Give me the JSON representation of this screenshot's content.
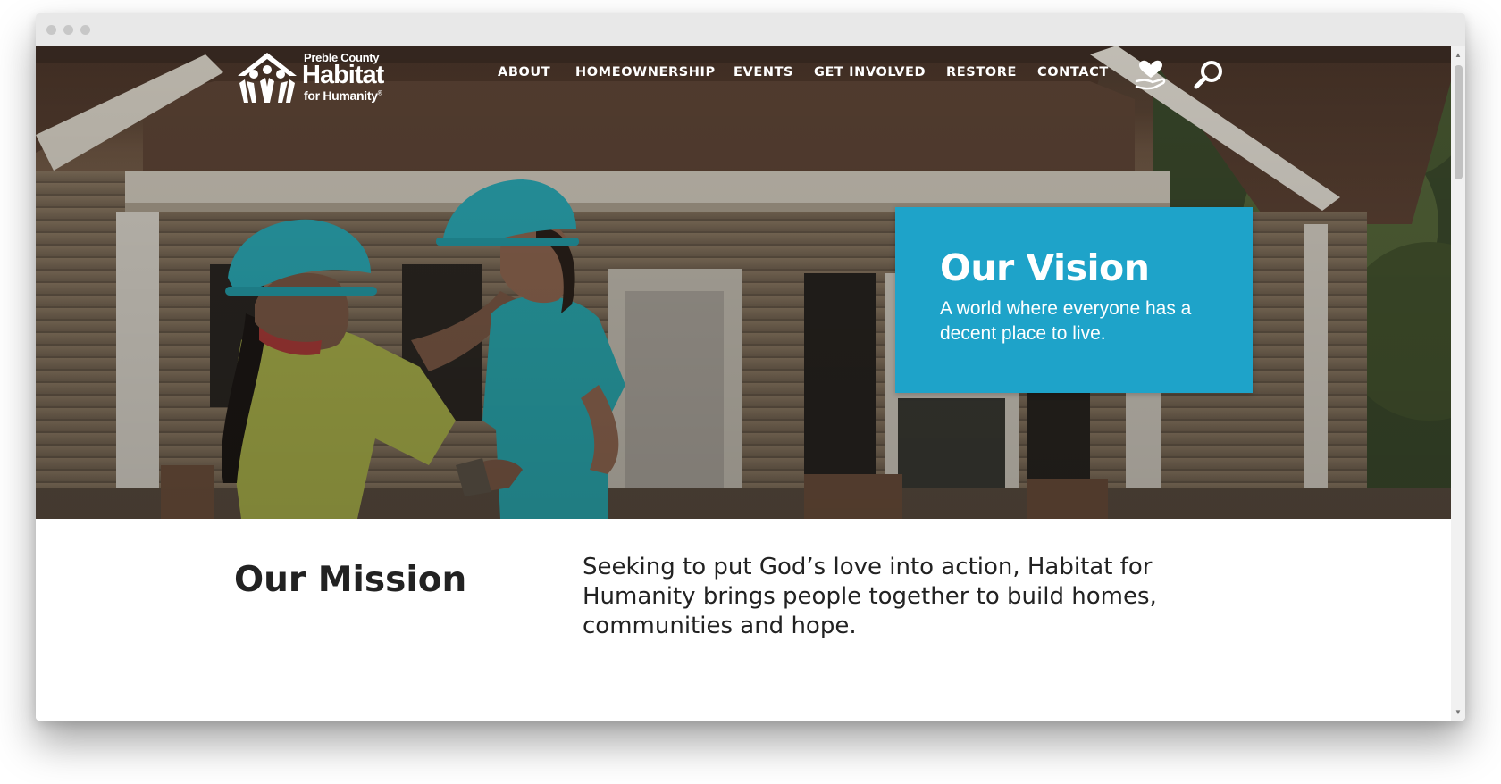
{
  "brand": {
    "county": "Preble County",
    "name": "Habitat",
    "subtitle": "for Humanity",
    "registered": "®"
  },
  "nav": {
    "items": [
      "ABOUT",
      "HOMEOWNERSHIP",
      "EVENTS",
      "GET INVOLVED",
      "RESTORE",
      "CONTACT"
    ],
    "donate_icon": "heart-hand-icon",
    "search_icon": "search-icon"
  },
  "hero": {
    "vision_title": "Our Vision",
    "vision_text": "A world where everyone has a decent place to live."
  },
  "mission": {
    "title": "Our Mission",
    "text": "Seeking to put God’s love into action, Habitat for Humanity brings people together to build homes, communities and hope."
  },
  "colors": {
    "accent": "#1ea3c9",
    "text": "#222222",
    "window_chrome": "#e8e8e8"
  }
}
